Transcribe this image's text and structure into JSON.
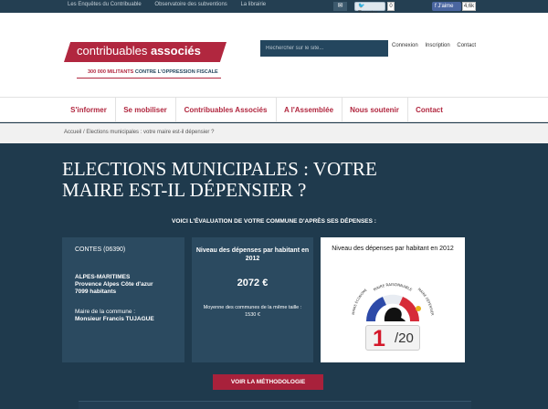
{
  "topbar": {
    "links": [
      "Les Enquêtes du Contribuable",
      "Observatoire des subventions",
      "La librairie"
    ],
    "mail_icon": "mail-icon",
    "tweet_label": "Tweeter",
    "tweet_count": "0",
    "like_label": "J'aime",
    "like_count": "4,6k"
  },
  "header": {
    "logo_main": "contribuables",
    "logo_bold": "associés",
    "logo_tagline_red": "300 000 MILITANTS",
    "logo_tagline_blue": "CONTRE L'OPPRESSION FISCALE",
    "search_placeholder": "Rechercher sur le site...",
    "links": [
      "Connexion",
      "Inscription",
      "Contact"
    ]
  },
  "nav": {
    "items": [
      "S'informer",
      "Se mobiliser",
      "Contribuables Associés",
      "A l'Assemblée",
      "Nous soutenir",
      "Contact"
    ]
  },
  "breadcrumb": "Accueil / Elections municipales : votre maire est-il dépensier ?",
  "main": {
    "title": "ELECTIONS MUNICIPALES : VOTRE MAIRE EST-IL DÉPENSIER ?",
    "subtitle": "VOICI L'ÉVALUATION DE VOTRE COMMUNE D'APRÈS SES DÉPENSES :",
    "commune": {
      "name": "CONTES (06390)",
      "dept": "ALPES-MARITIMES",
      "region": "Provence Alpes Côte d'azur",
      "population": "7099 habitants",
      "maire_label": "Maire de la commune :",
      "maire_name": "Monsieur Francis TUJAGUE"
    },
    "depenses": {
      "heading": "Niveau des dépenses par habitant en 2012",
      "value": "2072 €",
      "note": "Moyenne des communes de la même taille :",
      "note_value": "1530 €"
    },
    "rating": {
      "heading": "Niveau des dépenses par habitant en 2012",
      "arc_top": "MAIRE RAISONNABLE",
      "arc_left": "MAIRE ÉCONOME",
      "arc_right": "MAIRE DÉPENSIER",
      "score": "1",
      "scale": "/20"
    },
    "button": "VOIR LA MÉTHODOLOGIE"
  }
}
